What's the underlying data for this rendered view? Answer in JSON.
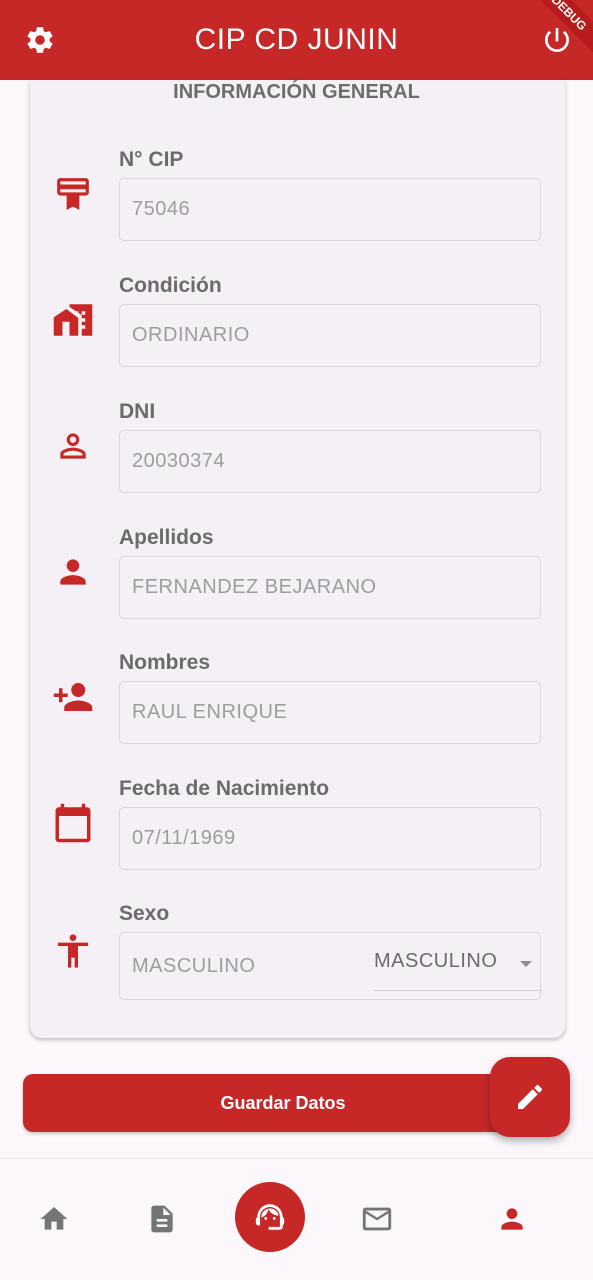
{
  "appbar": {
    "title": "CIP CD JUNIN",
    "debug_banner": "DEBUG",
    "settings_icon": "gear-icon",
    "power_icon": "power-icon"
  },
  "card": {
    "title": "INFORMACIÓN GENERAL",
    "fields": [
      {
        "label": "N° CIP",
        "value": "75046",
        "icon": "badge-icon"
      },
      {
        "label": "Condición",
        "value": "ORDINARIO",
        "icon": "home-work-icon"
      },
      {
        "label": "DNI",
        "value": "20030374",
        "icon": "person-outline-icon"
      },
      {
        "label": "Apellidos",
        "value": "FERNANDEZ BEJARANO",
        "icon": "person-icon"
      },
      {
        "label": "Nombres",
        "value": "RAUL ENRIQUE",
        "icon": "person-add-icon"
      },
      {
        "label": "Fecha de Nacimiento",
        "value": "07/11/1969",
        "icon": "calendar-icon"
      },
      {
        "label": "Sexo",
        "value": "MASCULINO",
        "icon": "accessibility-icon",
        "select_value": "MASCULINO"
      }
    ]
  },
  "actions": {
    "save_label": "Guardar Datos",
    "fab_icon": "edit-icon"
  },
  "bottom_nav": {
    "items": [
      "home-icon",
      "document-icon",
      "support-agent-icon",
      "mail-icon",
      "profile-icon"
    ],
    "active": "profile-icon"
  },
  "colors": {
    "primary": "#c62828",
    "label": "#6b6b6b",
    "value": "#9d9d9d"
  }
}
